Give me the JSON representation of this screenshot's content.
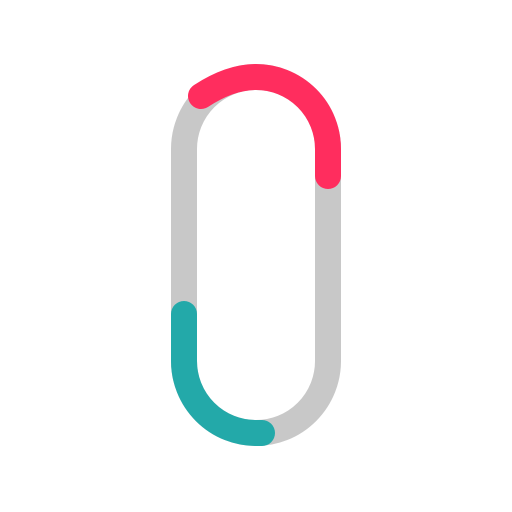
{
  "icon": {
    "name": "pill-loop-icon",
    "colors": {
      "background": "#ffffff",
      "track": "#c8c8c8",
      "accent_top": "#ff2d5e",
      "accent_bottom": "#23a9a9"
    }
  }
}
